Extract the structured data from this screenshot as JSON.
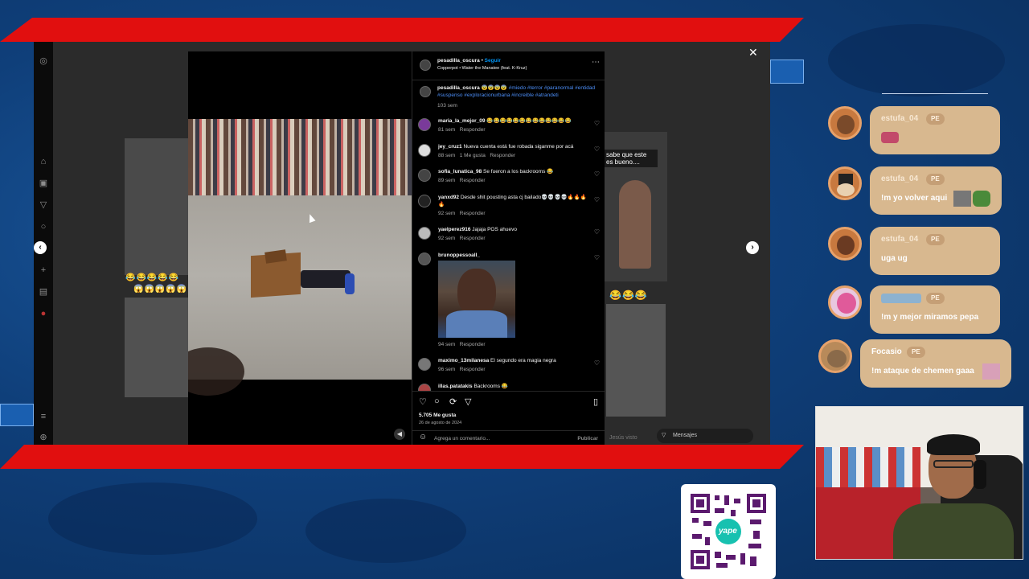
{
  "instagram": {
    "author": "pesadilla_oscura",
    "follow_label": "Seguir",
    "audio": "Copperpot • Water the Manatee (feat. K-Kruz)",
    "caption_user": "pesadilla_oscura",
    "caption_emojis": "😨😨😨😨",
    "caption_tags": "#miedo #terror #paranormal #entidad #suspenso #exploracionurbana #increible #atrandeti",
    "caption_time": "103 sem",
    "comments": [
      {
        "user": "maria_la_mejor_09",
        "text": "😂😂😂😂😂😂😂😂😂😂😂😂😂",
        "time": "81 sem",
        "likes": "",
        "reply": "Responder"
      },
      {
        "user": "jey_cruz1",
        "text": "Nueva cuenta está fue robada siganme por acá",
        "time": "88 sem",
        "likes": "1 Me gusta",
        "reply": "Responder"
      },
      {
        "user": "sofia_lunatica_98",
        "text": "Se fueron a los backrooms 😂",
        "time": "89 sem",
        "likes": "",
        "reply": "Responder"
      },
      {
        "user": "yanxd92",
        "text": "Desde shit pousting asta cj bailado💀💀💀💀🔥🔥🔥🔥",
        "time": "92 sem",
        "likes": "",
        "reply": "Responder"
      },
      {
        "user": "yaelperez916",
        "text": "Jajaja POS ahuevo",
        "time": "92 sem",
        "likes": "",
        "reply": "Responder"
      },
      {
        "user": "brunoppessoall_",
        "text": "",
        "time": "94 sem",
        "likes": "",
        "reply": "Responder"
      },
      {
        "user": "maximo_13milanesa",
        "text": "El segundo era magia negra",
        "time": "96 sem",
        "likes": "",
        "reply": "Responder"
      },
      {
        "user": "illas.patatakis",
        "text": "Backrooms 😂",
        "time": "",
        "likes": "",
        "reply": ""
      }
    ],
    "likes": "5.705 Me gusta",
    "date": "26 de agosto de 2024",
    "comment_placeholder": "Agrega un comentario...",
    "publish_label": "Publicar",
    "messages_label": "Mensajes",
    "bg_right_text": "sabe que este\nes bueno....",
    "bg_footer": "Jesús visto",
    "bg_emoji_left": "😂😂😂😂😂",
    "bg_emoji_left2": "😱😱😱😱😱",
    "bg_emoji_right": "😂😂😂"
  },
  "chat": [
    {
      "user": "estufa_04",
      "badge": "PE",
      "text": ""
    },
    {
      "user": "estufa_04",
      "badge": "PE",
      "text": "!m yo volver aqui"
    },
    {
      "user": "estufa_04",
      "badge": "PE",
      "text": "uga ug"
    },
    {
      "user": "",
      "badge": "PE",
      "text": "!m y mejor miramos pepa"
    },
    {
      "user": "Focasio",
      "badge": "PE",
      "text": "!m ataque de chemen gaaa"
    }
  ],
  "qr_label": "yape"
}
